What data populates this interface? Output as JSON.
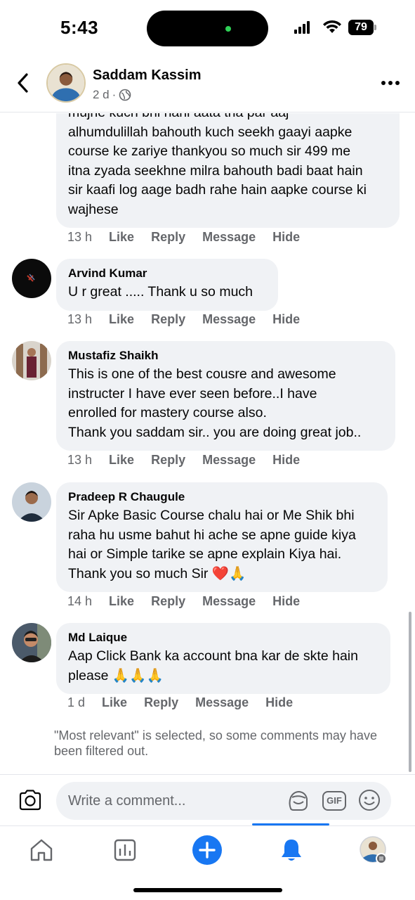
{
  "status_bar": {
    "time": "5:43",
    "battery": "79"
  },
  "post": {
    "author": "Saddam Kassim",
    "age": "2 d",
    "separator": "·"
  },
  "comments": [
    {
      "name": "",
      "text": "mujhe kuch bhi nahi aata tha par aaj\nalhumdulillah bahouth kuch seekh gaayi aapke\ncourse ke zariye thankyou so much sir 499 me\nitna zyada seekhne milra bahouth badi baat hain\nsir kaafi log aage badh rahe hain aapke course ki\nwajhese",
      "time": "13 h"
    },
    {
      "name": "Arvind Kumar",
      "text": "U r great ..... Thank u so much",
      "time": "13 h"
    },
    {
      "name": "Mustafiz Shaikh",
      "text": "This is one of the best cousre and awesome\ninstructer I have ever seen before..I have\nenrolled for mastery course also.\nThank you saddam sir.. you are doing great job..",
      "time": "13 h"
    },
    {
      "name": "Pradeep R Chaugule",
      "text": "Sir Apke Basic Course chalu hai or Me Shik bhi\nraha hu usme bahut hi ache se apne guide kiya\nhai or Simple tarike se apne explain Kiya hai.\nThank you so much Sir ❤️🙏",
      "time": "14 h"
    },
    {
      "name": "Md Laique",
      "text": "Aap Click Bank ka account bna kar de skte hain\nplease 🙏🙏🙏",
      "time": "1 d"
    }
  ],
  "actions": {
    "like": "Like",
    "reply": "Reply",
    "message": "Message",
    "hide": "Hide"
  },
  "filter_note": "\"Most relevant\" is selected, so some comments may have been filtered out.",
  "composer": {
    "placeholder": "Write a comment...",
    "gif_label": "GIF"
  },
  "icons": {
    "back": "back-chevron-icon",
    "more": "more-dots-icon",
    "globe": "globe-icon",
    "camera": "camera-icon",
    "avatar_sticker": "avatar-sticker-icon",
    "gif": "gif-icon",
    "emoji": "emoji-icon",
    "tabs": [
      "home-icon",
      "dashboard-icon",
      "create-plus-icon",
      "notifications-bell-icon",
      "profile-avatar-icon"
    ]
  },
  "colors": {
    "accent": "#1877f2",
    "bubble": "#f0f2f5",
    "secondary_text": "#65676b",
    "heart": "#e0245e"
  }
}
